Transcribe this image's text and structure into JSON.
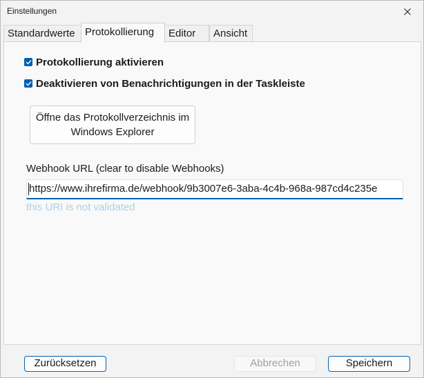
{
  "window": {
    "title": "Einstellungen",
    "close_icon": "close-icon"
  },
  "tabs": [
    {
      "label": "Standardwerte",
      "active": false
    },
    {
      "label": "Protokollierung",
      "active": true
    },
    {
      "label": "Editor",
      "active": false
    },
    {
      "label": "Ansicht",
      "active": false
    }
  ],
  "logging": {
    "enable_label": "Protokollierung aktivieren",
    "enable_checked": true,
    "disable_notifications_label": "Deaktivieren von Benachrichtigungen in der Taskleiste",
    "disable_notifications_checked": true,
    "open_folder_line1": "Öffne das Protokollverzeichnis im",
    "open_folder_line2": "Windows Explorer"
  },
  "webhook": {
    "label": "Webhook URL (clear to disable Webhooks)",
    "value": "https://www.ihrefirma.de/webhook/9b3007e6-3aba-4c4b-968a-987cd4c235e",
    "hint": "this URI is not validated"
  },
  "footer": {
    "reset_label": "Zurücksetzen",
    "cancel_label": "Abbrechen",
    "cancel_enabled": false,
    "save_label": "Speichern"
  },
  "colors": {
    "accent": "#005fb8",
    "hint": "#a9d0ea",
    "disabled_text": "#a0a0a0"
  }
}
